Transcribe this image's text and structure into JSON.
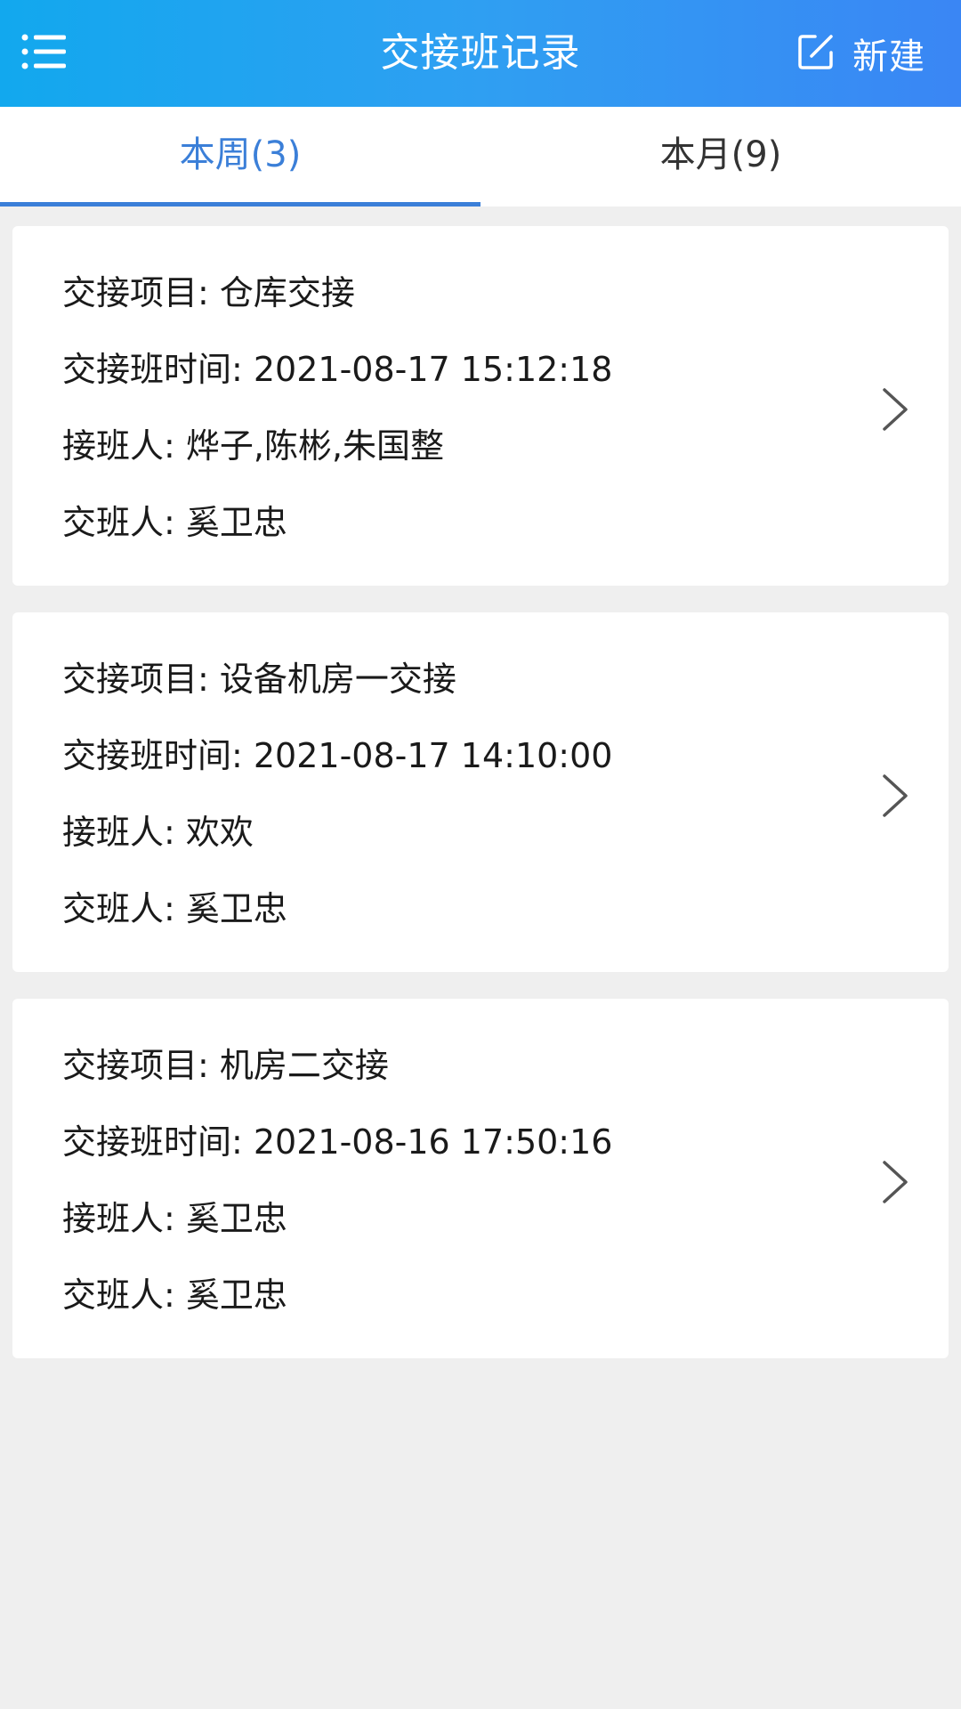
{
  "header": {
    "title": "交接班记录",
    "new_label": "新建",
    "menu_icon": "menu-icon",
    "edit_icon": "edit-icon"
  },
  "tabs": [
    {
      "label": "本周(3)",
      "active": true
    },
    {
      "label": "本月(9)",
      "active": false
    }
  ],
  "records": [
    {
      "project": "交接项目: 仓库交接",
      "time": "交接班时间: 2021-08-17 15:12:18",
      "receiver": "接班人: 烨子,陈彬,朱国整",
      "handover": "交班人: 奚卫忠"
    },
    {
      "project": "交接项目: 设备机房一交接",
      "time": "交接班时间: 2021-08-17 14:10:00",
      "receiver": "接班人: 欢欢",
      "handover": "交班人: 奚卫忠"
    },
    {
      "project": "交接项目: 机房二交接",
      "time": "交接班时间: 2021-08-16 17:50:16",
      "receiver": "接班人: 奚卫忠",
      "handover": "交班人: 奚卫忠"
    }
  ],
  "colors": {
    "header_start": "#12a8ee",
    "header_end": "#3a86f4",
    "active_tab": "#3b7fd8",
    "background": "#efefef"
  }
}
